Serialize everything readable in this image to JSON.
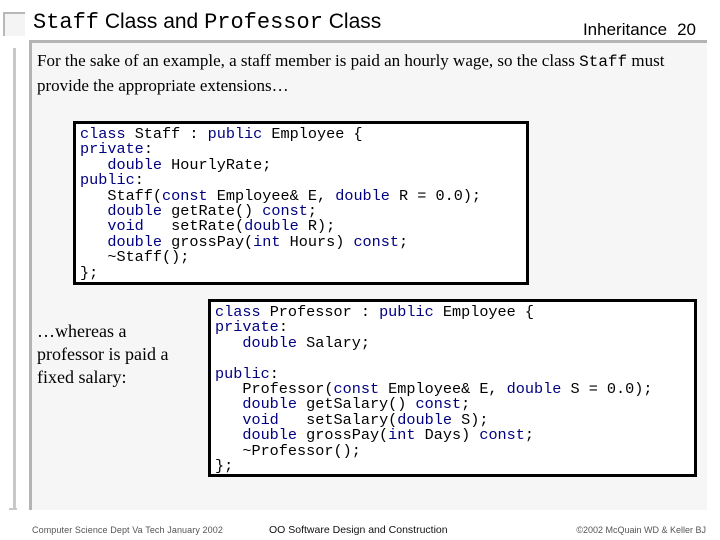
{
  "header": {
    "title_parts": [
      {
        "text": "Staff",
        "style": "mono"
      },
      {
        "text": " Class and ",
        "style": "sans"
      },
      {
        "text": "Professor",
        "style": "mono"
      },
      {
        "text": " Class",
        "style": "sans"
      }
    ],
    "section": "Inheritance",
    "slide_number": "20"
  },
  "intro": {
    "text_before": "For the sake of an example, a staff member is paid an hourly wage, so the class ",
    "code_word": "Staff",
    "text_after": " must provide the appropriate extensions…"
  },
  "staff_code": {
    "lines": [
      [
        {
          "t": "class",
          "k": 1
        },
        {
          "t": " Staff : "
        },
        {
          "t": "public",
          "k": 1
        },
        {
          "t": " Employee {"
        }
      ],
      [
        {
          "t": "private",
          "k": 1
        },
        {
          "t": ":"
        }
      ],
      [
        {
          "t": "   "
        },
        {
          "t": "double",
          "k": 1
        },
        {
          "t": " HourlyRate;"
        }
      ],
      [
        {
          "t": "public",
          "k": 1
        },
        {
          "t": ":"
        }
      ],
      [
        {
          "t": "   Staff("
        },
        {
          "t": "const",
          "k": 1
        },
        {
          "t": " Employee& E, "
        },
        {
          "t": "double",
          "k": 1
        },
        {
          "t": " R = 0.0);"
        }
      ],
      [
        {
          "t": "   "
        },
        {
          "t": "double",
          "k": 1
        },
        {
          "t": " getRate() "
        },
        {
          "t": "const",
          "k": 1
        },
        {
          "t": ";"
        }
      ],
      [
        {
          "t": "   "
        },
        {
          "t": "void",
          "k": 1
        },
        {
          "t": "   setRate("
        },
        {
          "t": "double",
          "k": 1
        },
        {
          "t": " R);"
        }
      ],
      [
        {
          "t": "   "
        },
        {
          "t": "double",
          "k": 1
        },
        {
          "t": " grossPay("
        },
        {
          "t": "int",
          "k": 1
        },
        {
          "t": " Hours) "
        },
        {
          "t": "const",
          "k": 1
        },
        {
          "t": ";"
        }
      ],
      [
        {
          "t": "   ~Staff();"
        }
      ],
      [
        {
          "t": "};"
        }
      ]
    ]
  },
  "side_text": "…whereas a professor is paid a fixed salary:",
  "professor_code": {
    "lines": [
      [
        {
          "t": "class",
          "k": 1
        },
        {
          "t": " Professor : "
        },
        {
          "t": "public",
          "k": 1
        },
        {
          "t": " Employee {"
        }
      ],
      [
        {
          "t": "private",
          "k": 1
        },
        {
          "t": ":"
        }
      ],
      [
        {
          "t": "   "
        },
        {
          "t": "double",
          "k": 1
        },
        {
          "t": " Salary;"
        }
      ],
      [
        {
          "t": ""
        }
      ],
      [
        {
          "t": "public",
          "k": 1
        },
        {
          "t": ":"
        }
      ],
      [
        {
          "t": "   Professor("
        },
        {
          "t": "const",
          "k": 1
        },
        {
          "t": " Employee& E, "
        },
        {
          "t": "double",
          "k": 1
        },
        {
          "t": " S = 0.0);"
        }
      ],
      [
        {
          "t": "   "
        },
        {
          "t": "double",
          "k": 1
        },
        {
          "t": " getSalary() "
        },
        {
          "t": "const",
          "k": 1
        },
        {
          "t": ";"
        }
      ],
      [
        {
          "t": "   "
        },
        {
          "t": "void",
          "k": 1
        },
        {
          "t": "   setSalary("
        },
        {
          "t": "double",
          "k": 1
        },
        {
          "t": " S);"
        }
      ],
      [
        {
          "t": "   "
        },
        {
          "t": "double",
          "k": 1
        },
        {
          "t": " grossPay("
        },
        {
          "t": "int",
          "k": 1
        },
        {
          "t": " Days) "
        },
        {
          "t": "const",
          "k": 1
        },
        {
          "t": ";"
        }
      ],
      [
        {
          "t": "   ~Professor();"
        }
      ],
      [
        {
          "t": "};"
        }
      ]
    ]
  },
  "footer": {
    "left": "Computer Science Dept Va Tech January 2002",
    "center": "OO Software Design and Construction",
    "right": "©2002  McQuain WD & Keller BJ"
  },
  "colors": {
    "keyword": "#000080",
    "panel_bg": "#f6f6f6",
    "rule": "#b4b4b4"
  }
}
